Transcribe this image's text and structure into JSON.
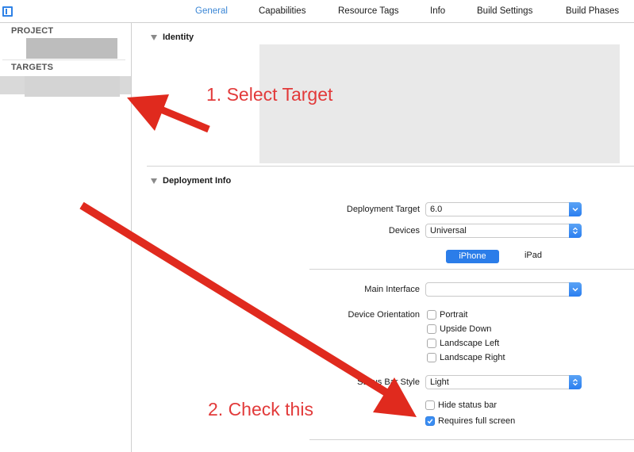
{
  "toolbar": {
    "sidebar_toggle_icon": "sidebar-toggle-icon",
    "tabs": [
      {
        "label": "General",
        "active": true
      },
      {
        "label": "Capabilities",
        "active": false
      },
      {
        "label": "Resource Tags",
        "active": false
      },
      {
        "label": "Info",
        "active": false
      },
      {
        "label": "Build Settings",
        "active": false
      },
      {
        "label": "Build Phases",
        "active": false
      }
    ],
    "accent_color": "#3a86d5"
  },
  "sidebar": {
    "project_header": "PROJECT",
    "targets_header": "TARGETS"
  },
  "identity": {
    "title": "Identity"
  },
  "deployment": {
    "title": "Deployment Info",
    "deployment_target": {
      "label": "Deployment Target",
      "value": "6.0"
    },
    "devices": {
      "label": "Devices",
      "value": "Universal"
    },
    "device_tabs": [
      {
        "label": "iPhone",
        "selected": true
      },
      {
        "label": "iPad",
        "selected": false
      }
    ],
    "main_interface": {
      "label": "Main Interface",
      "value": ""
    },
    "device_orientation": {
      "label": "Device Orientation",
      "options": [
        {
          "label": "Portrait",
          "checked": false
        },
        {
          "label": "Upside Down",
          "checked": false
        },
        {
          "label": "Landscape Left",
          "checked": false
        },
        {
          "label": "Landscape Right",
          "checked": false
        }
      ]
    },
    "status_bar_style": {
      "label": "Status Bar Style",
      "value": "Light"
    },
    "hide_status_bar": {
      "label": "Hide status bar",
      "checked": false
    },
    "requires_full_screen": {
      "label": "Requires full screen",
      "checked": true
    }
  },
  "annotations": {
    "step1": "1. Select Target",
    "step2": "2. Check this",
    "color": "#e02a1e"
  }
}
